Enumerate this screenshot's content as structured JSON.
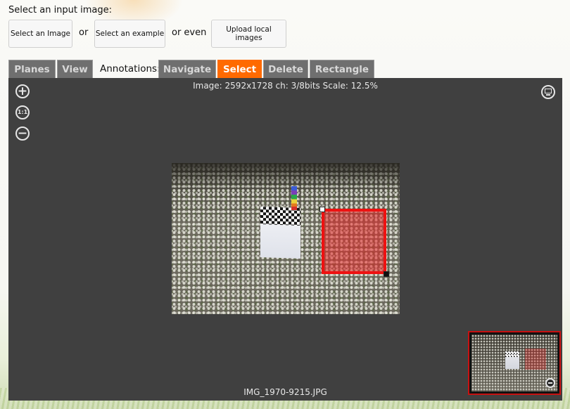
{
  "header": {
    "prompt": "Select an input image:",
    "buttons": {
      "select_image": "Select an Image",
      "select_example": "Select an example",
      "upload_local": "Upload local images"
    },
    "separators": {
      "or": "or",
      "or_even": "or even"
    }
  },
  "tabs": {
    "planes": "Planes",
    "view": "View",
    "annotations_label": "Annotations:",
    "navigate": "Navigate",
    "select": "Select",
    "delete": "Delete",
    "rectangle": "Rectangle",
    "active": "Select"
  },
  "viewer": {
    "info": "Image: 2592x1728 ch: 3/8bits Scale: 12.5%",
    "filename": "IMG_1970-9215.JPG",
    "zoom_in_glyph": "+",
    "zoom_reset_glyph": "1:1",
    "zoom_out_glyph": "−",
    "icons": [
      "zoom-in-icon",
      "zoom-reset-icon",
      "zoom-out-icon",
      "fullscreen-icon",
      "minimize-icon"
    ],
    "selection_color": "#ee1111"
  },
  "colors": {
    "active_tab": "#ff6a00",
    "inactive_tab": "#6f6f6f",
    "viewer_bg": "#404040"
  }
}
